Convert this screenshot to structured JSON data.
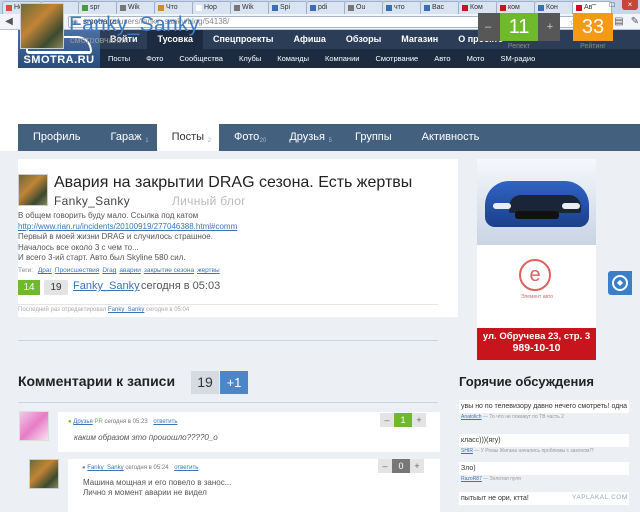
{
  "browser": {
    "tabs": [
      {
        "label": "Новое",
        "color": "#e24a3b"
      },
      {
        "label": "Wik",
        "color": "#777777"
      },
      {
        "label": "spr",
        "color": "#4a9c3a"
      },
      {
        "label": "Wik",
        "color": "#777777"
      },
      {
        "label": "Что",
        "color": "#d38a2c"
      },
      {
        "label": "Нор",
        "color": "#ffffff"
      },
      {
        "label": "Wik",
        "color": "#777777"
      },
      {
        "label": "Spi",
        "color": "#3a6cb8"
      },
      {
        "label": "pdi",
        "color": "#3a6cb8"
      },
      {
        "label": "Ou",
        "color": "#777777"
      },
      {
        "label": "что",
        "color": "#3a6cb8"
      },
      {
        "label": "Вас",
        "color": "#3a6cb8"
      },
      {
        "label": "Ком",
        "color": "#c8141c"
      },
      {
        "label": "ком",
        "color": "#c8141c"
      },
      {
        "label": "Кон",
        "color": "#3a6cb8"
      },
      {
        "label": "Ав",
        "color": "#c8141c"
      }
    ],
    "url_host": "smotra.ru",
    "url_path": "/users/fanky_sanky/blog/54138/",
    "window_controls": [
      "–",
      "□",
      "×"
    ]
  },
  "site": {
    "logo_text": "SMOTRA.RU",
    "main_nav": [
      "Войти",
      "Тусовка",
      "Спецпроекты",
      "Афиша",
      "Обзоры",
      "Магазин",
      "О проекте"
    ],
    "sub_nav": [
      "Посты",
      "Фото",
      "Сообщества",
      "Клубы",
      "Команды",
      "Компании",
      "Смотрвание",
      "Авто",
      "Мото",
      "SM-радио"
    ]
  },
  "profile": {
    "username": "Fanky_Sanky",
    "subtitle": "смотровчанин",
    "reputation": "11",
    "reputation_label": "Репект",
    "rating": "33",
    "rating_label": "Рейтинг",
    "minus": "–",
    "plus": "+"
  },
  "tabs": [
    {
      "label": "Профиль",
      "count": ""
    },
    {
      "label": "Гараж",
      "count": "1"
    },
    {
      "label": "Посты",
      "count": "2"
    },
    {
      "label": "Фото",
      "count": "20"
    },
    {
      "label": "Друзья",
      "count": "5"
    },
    {
      "label": "Группы",
      "count": ""
    },
    {
      "label": "Активность",
      "count": ""
    }
  ],
  "post": {
    "title": "Авария на закрытии DRAG сезона. Есть жертвы",
    "author": "Fanky_Sanky",
    "blog_label": "Личный блог",
    "body": [
      "В общем говорить буду мало. Ссылка под катом",
      "http://www.rian.ru/incidents/20100919/277046388.html#comm",
      "Первый в моей жизни DRAG и случилось страшное.",
      "Началось все около 3 с чем то...",
      "И всего 3-ий старт. Авто был Skyline 580 сил."
    ],
    "tags_label": "Теги:",
    "tags": [
      "Драг",
      "Происшествия",
      "Drag",
      "аварии",
      "закрытие сезона",
      "жертвы"
    ],
    "votes_up": "14",
    "votes_count": "19",
    "time": "сегодня в 05:03",
    "edited_prefix": "Последний раз отредактировал",
    "edited_user": "Fanky_Sanky",
    "edited_time": "сегодня в 05:04"
  },
  "ad": {
    "logo_letter": "e",
    "tagline": "Элемент авто",
    "address": "ул. Обручева 23, стр. 3",
    "phone": "989-10-10"
  },
  "comments": {
    "title": "Комментарии к записи",
    "count": "19",
    "add": "+1",
    "items": [
      {
        "user": "Друзья",
        "rating": "PR",
        "time": "сегодня в 05:23",
        "reply": "ответить",
        "text": "каким образом это проиошло????0_о",
        "vote": "1",
        "vote_color": "#6fba2c"
      },
      {
        "user": "Fanky_Sanky",
        "rating": "",
        "time": "сегодня в 05:24",
        "reply": "ответить",
        "text_lines": [
          "Машина мощная и его повело в занос...",
          "Лично я момент аварии не видел"
        ],
        "vote": "0",
        "vote_color": "#777777"
      }
    ]
  },
  "hot": {
    "title": "Горячие обсуждения",
    "items": [
      {
        "text": "увы но по телевизору давно нечего смотреть! одна ложь! даже уже футбол! игры сливают на раз два тря",
        "user": "Anatolich",
        "meta": "— То что не покажут по ТВ часть 2"
      },
      {
        "text": "класс)))(ягу)",
        "user": "SHIR",
        "meta": "— У Ромы Жигана начались проблемы с законом!?"
      },
      {
        "text": "Зло)",
        "user": "RazoR87",
        "meta": "— Золотая пуля"
      },
      {
        "text": "пытыыт не ори, ктта!",
        "user": "",
        "meta": ""
      }
    ]
  },
  "watermark": "YAPLAKAL.COM"
}
